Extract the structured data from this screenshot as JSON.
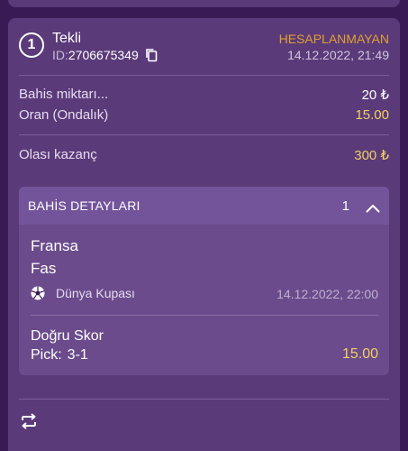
{
  "header": {
    "index": "1",
    "bet_type": "Tekli",
    "id_label": "ID:",
    "id_value": "2706675349",
    "status": "HESAPLANMAYAN",
    "datetime": "14.12.2022, 21:49"
  },
  "summary": {
    "stake_label": "Bahis miktarı...",
    "stake_value": "20 ₺",
    "odds_label": "Oran (Ondalık)",
    "odds_value": "15.00",
    "potential_label": "Olası kazanç",
    "potential_value": "300 ₺"
  },
  "details": {
    "title": "BAHİS DETAYLARI",
    "count": "1",
    "home_team": "Fransa",
    "away_team": "Fas",
    "league": "Dünya Kupası",
    "match_datetime": "14.12.2022, 22:00",
    "market": "Doğru Skor",
    "pick_label": "Pick:",
    "pick_value": "3-1",
    "pick_odds": "15.00"
  },
  "icons": {
    "copy": "copy-icon",
    "sport": "soccer-ball-icon",
    "collapse": "chevron-up-icon",
    "repeat": "repeat-icon"
  },
  "colors": {
    "background": "#3a1a55",
    "card": "#5b3a7a",
    "status": "#e0a030",
    "odds": "#f0d060"
  }
}
